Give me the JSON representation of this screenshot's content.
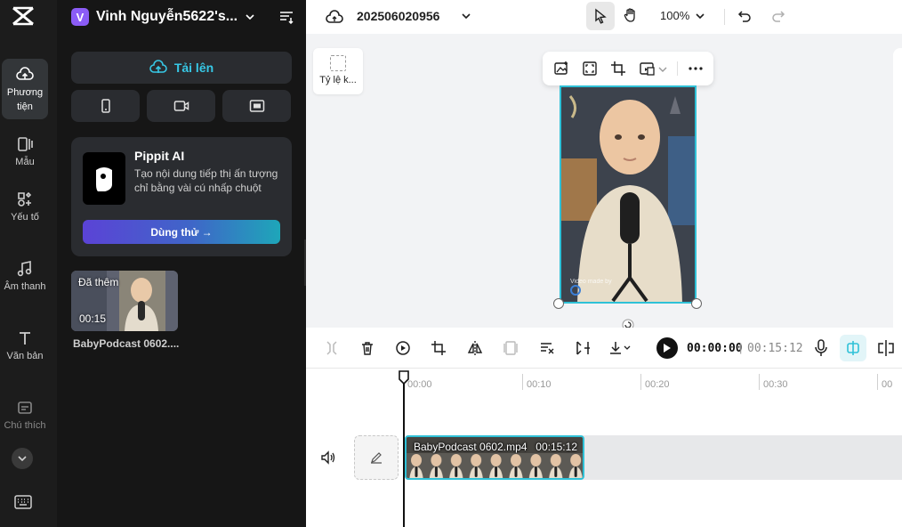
{
  "rail": {
    "items": [
      {
        "label": "Phương tiện"
      },
      {
        "label": "Mẫu"
      },
      {
        "label": "Yếu tố"
      },
      {
        "label": "Âm thanh"
      },
      {
        "label": "Văn bản"
      },
      {
        "label": "Chú thích"
      }
    ]
  },
  "panel": {
    "workspace_initial": "V",
    "workspace_name": "Vinh Nguyễn5622's...",
    "upload_label": "Tải lên",
    "pippit": {
      "title": "Pippit AI",
      "description": "Tạo nội dung tiếp thị ấn tượng chỉ bằng vài cú nhấp chuột",
      "cta": "Dùng thử →"
    },
    "media": {
      "badge": "Đã thêm",
      "duration": "00:15",
      "name": "BabyPodcast 0602...."
    }
  },
  "topbar": {
    "project_title": "202506020956",
    "zoom": "100%"
  },
  "canvas": {
    "ratio_label": "Tỷ lệ k...",
    "watermark": "Video made by"
  },
  "timeline": {
    "current_time": "00:00:00",
    "separator": "|",
    "total_time": "00:15:12",
    "ruler_labels": [
      "00:00",
      "00:10",
      "00:20",
      "00:30",
      "00"
    ],
    "clip_name": "BabyPodcast 0602.mp4",
    "clip_duration": "00:15:12"
  },
  "colors": {
    "accent": "#2fc1d7",
    "workspace_avatar": "#8b5cf6",
    "rail_bg": "#1c1c1c",
    "panel_bg": "#161616"
  }
}
